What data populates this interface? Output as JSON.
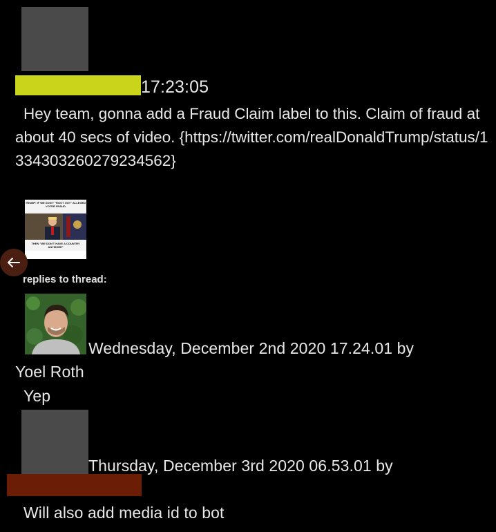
{
  "message": {
    "timestamp": "17:23:05",
    "body": "Hey team, gonna add a Fraud Claim label to this. Claim of fraud at about 40 secs of video. {https://twitter.com/realDonaldTrump/status/1334303260279234562}",
    "attachment": {
      "top_caption": "TRUMP: IF WE DON'T \"ROOT OUT\" ALLEGED VOTER FRAUD",
      "bottom_caption": "THEN \"WE DON'T HAVE A COUNTRY ANYMORE\""
    }
  },
  "thread": {
    "header": "replies to thread:",
    "replies": [
      {
        "meta": "Wednesday, December 2nd 2020 17.24.01 by",
        "author": "Yoel Roth",
        "body": "Yep"
      },
      {
        "meta": "Thursday, December 3rd 2020 06.53.01 by",
        "body": "Will also add media id to bot"
      }
    ]
  },
  "nav": {
    "back_icon": "arrow-left-icon"
  },
  "colors": {
    "background": "#000000",
    "text": "#e8e8e8",
    "redaction_yellow": "#c9d41b",
    "redaction_red": "#6b1e05",
    "back_button": "#4a1f12",
    "avatar_redacted": "#4a4a4a"
  }
}
